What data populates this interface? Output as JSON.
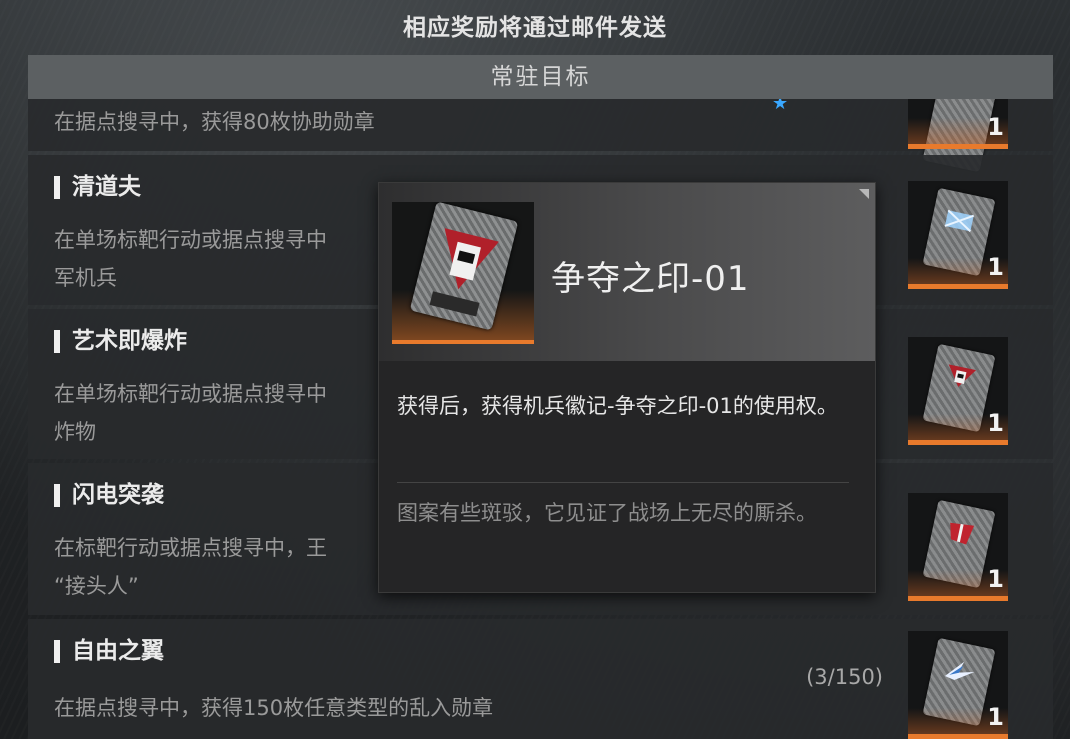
{
  "notice": "相应奖励将通过邮件发送",
  "section_header": "常驻目标",
  "tasks": [
    {
      "title": "",
      "desc": "在据点搜寻中，获得80枚协助勋章",
      "progress": "",
      "reward_qty": "1"
    },
    {
      "title": "清道夫",
      "desc": "在单场标靶行动或据点搜寻中",
      "desc2": "军机兵",
      "progress": "",
      "reward_qty": "1"
    },
    {
      "title": "艺术即爆炸",
      "desc": "在单场标靶行动或据点搜寻中",
      "desc2": "炸物",
      "progress": "",
      "reward_qty": "1"
    },
    {
      "title": "闪电突袭",
      "desc": "在标靶行动或据点搜寻中，王",
      "desc2": "“接头人”",
      "progress": "",
      "reward_qty": "1"
    },
    {
      "title": "自由之翼",
      "desc": "在据点搜寻中，获得150枚任意类型的乱入勋章",
      "progress": "(3/150)",
      "reward_qty": "1"
    }
  ],
  "tooltip": {
    "name": "争夺之印-01",
    "body": "获得后，获得机兵徽记-争夺之印-01的使用权。",
    "flavor": "图案有些斑驳，它见证了战场上无尽的厮杀。"
  },
  "colors": {
    "accent": "#e87a2c",
    "header_bg": "#5c6062",
    "star": "#3aa8ff"
  },
  "icons": {
    "star": "star-icon",
    "corner": "corner-triangle-icon"
  }
}
